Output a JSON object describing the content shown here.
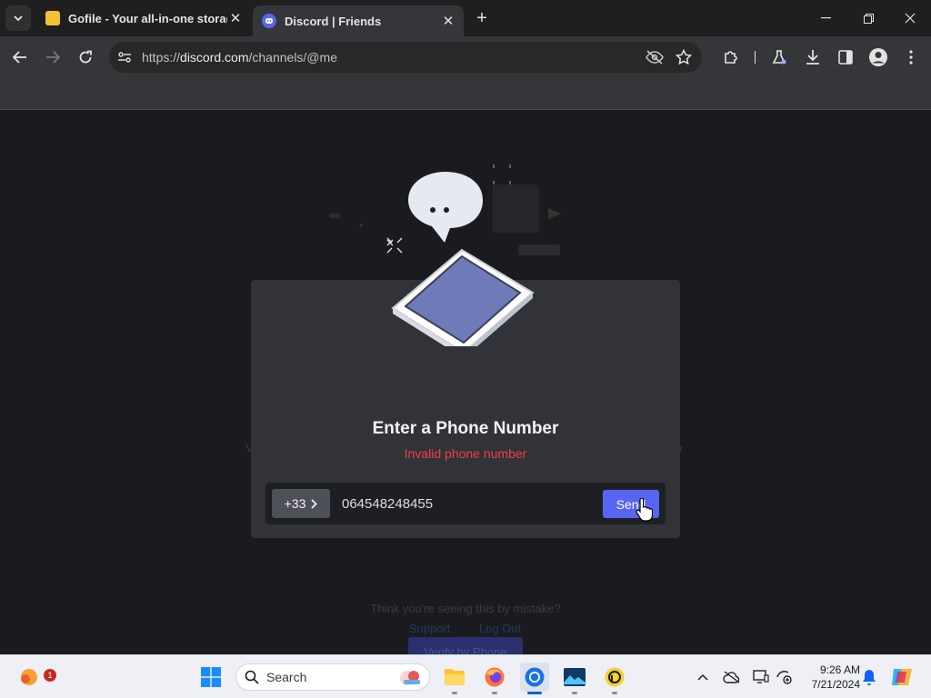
{
  "browser": {
    "tabs": [
      {
        "title": "Gofile - Your all-in-one storage",
        "active": false
      },
      {
        "title": "Discord | Friends",
        "active": true
      }
    ],
    "url_prefix": "https://",
    "url_host": "discord.com",
    "url_path": "/channels/@me"
  },
  "modal": {
    "title": "Enter a Phone Number",
    "error": "Invalid phone number",
    "country_code": "+33",
    "phone_value": "064548248455",
    "send_label": "Send"
  },
  "background": {
    "verify_button": "Verify by Phone",
    "mistake_text": "Think you're seeing this by mistake?",
    "support_link": "Support",
    "logout_link": "Log Out"
  },
  "taskbar": {
    "search_label": "Search",
    "time": "9:26 AM",
    "date": "7/21/2024",
    "weather_badge": "1"
  },
  "colors": {
    "accent": "#5865f2",
    "error": "#f23f43"
  }
}
